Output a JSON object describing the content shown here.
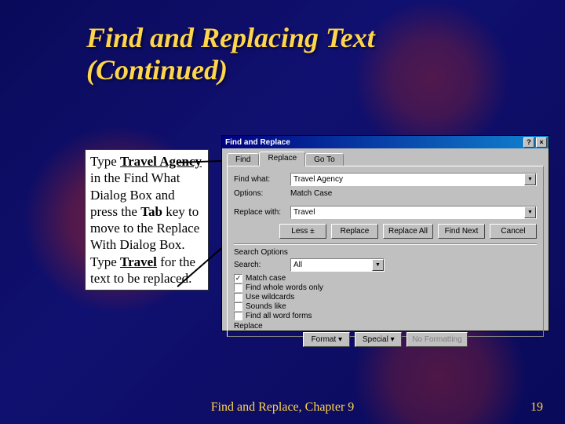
{
  "title_line1": "Find and Replacing Text",
  "title_line2": "(Continued)",
  "instruction": {
    "pre1": "Type ",
    "bold1": "Travel Agency",
    "mid1": " in the Find What Dialog Box and press the ",
    "bold2": "Tab",
    "mid2": " key to move to the Replace With Dialog Box. Type ",
    "bold3": "Travel",
    "post": " for the text to be replaced."
  },
  "dialog": {
    "title": "Find and Replace",
    "help_btn": "?",
    "close_btn": "×",
    "tabs": {
      "find": "Find",
      "replace": "Replace",
      "goto": "Go To"
    },
    "find_what_label": "Find what:",
    "find_what_value": "Travel Agency",
    "options_label": "Options:",
    "options_value": "Match Case",
    "replace_with_label": "Replace with:",
    "replace_with_value": "Travel",
    "buttons": {
      "less": "Less ±",
      "replace": "Replace",
      "replace_all": "Replace All",
      "find_next": "Find Next",
      "cancel": "Cancel",
      "format": "Format ▾",
      "special": "Special ▾",
      "no_formatting": "No Formatting"
    },
    "search_options_label": "Search Options",
    "search_label": "Search:",
    "search_value": "All",
    "checks": {
      "match_case": "Match case",
      "whole_words": "Find whole words only",
      "wildcards": "Use wildcards",
      "sounds_like": "Sounds like",
      "all_forms": "Find all word forms"
    },
    "replace_section": "Replace"
  },
  "footer": {
    "chapter": "Find and Replace, Chapter 9",
    "page": "19"
  }
}
